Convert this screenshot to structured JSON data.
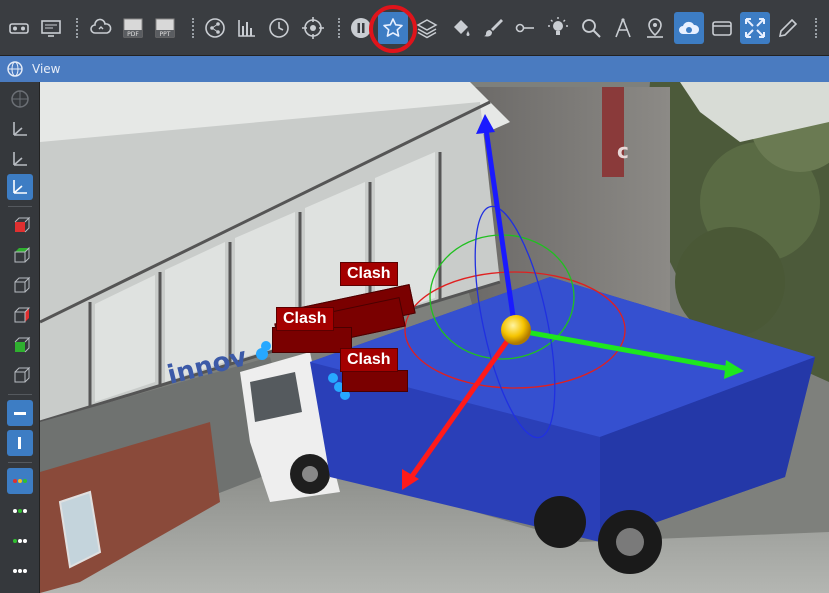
{
  "view": {
    "title": "View"
  },
  "clash_labels": [
    "Clash",
    "Clash",
    "Clash"
  ],
  "toolbar": {
    "buttons": [
      "vr-goggles-icon",
      "monitor-settings-icon",
      "cloud-sync-icon",
      "pdf-export-icon",
      "ppt-export-icon",
      "share-icon",
      "histogram-icon",
      "clock-icon",
      "target-icon",
      "pause-icon",
      "star-icon",
      "layers-icon",
      "paint-bucket-icon",
      "brush-icon",
      "key-icon",
      "light-bulb-icon",
      "magnify-icon",
      "compass-icon",
      "location-pin-icon",
      "cloud-view-icon",
      "box-icon",
      "move-arrows-icon",
      "pencil-icon"
    ],
    "highlighted": "star-icon",
    "active": [
      "cloud-view-icon",
      "move-arrows-icon"
    ]
  },
  "colors": {
    "highlight_ring": "#e0141b",
    "active_button": "#3d7dc4",
    "clash_label": "#a40000",
    "axis_x": "#ff1a1a",
    "axis_y": "#1ee61e",
    "axis_z": "#1a1aff",
    "gizmo_center": "#f5c400",
    "truck_body": "#2a3fb8"
  }
}
